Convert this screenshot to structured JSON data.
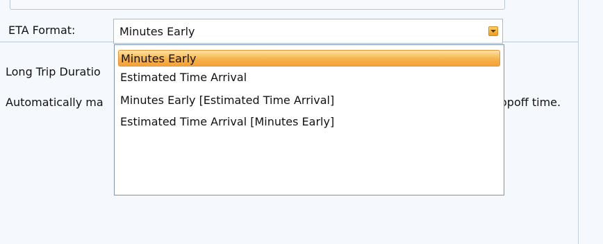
{
  "form": {
    "eta_label": "ETA Format:",
    "long_trip_label": "Long Trip Duratio",
    "auto_text_left": "Automatically ma",
    "auto_text_right": "opoff time."
  },
  "eta_combo": {
    "value": "Minutes Early",
    "options": [
      "Minutes Early",
      "Estimated Time Arrival",
      "Minutes Early [Estimated Time Arrival]",
      "Estimated Time Arrival [Minutes Early]"
    ],
    "selected_index": 0
  },
  "colors": {
    "highlight": "#f8b24a",
    "border": "#7b93b4",
    "panel_bg": "#f5f8fc"
  },
  "icons": {
    "combo_button": "chevron-down-icon"
  }
}
